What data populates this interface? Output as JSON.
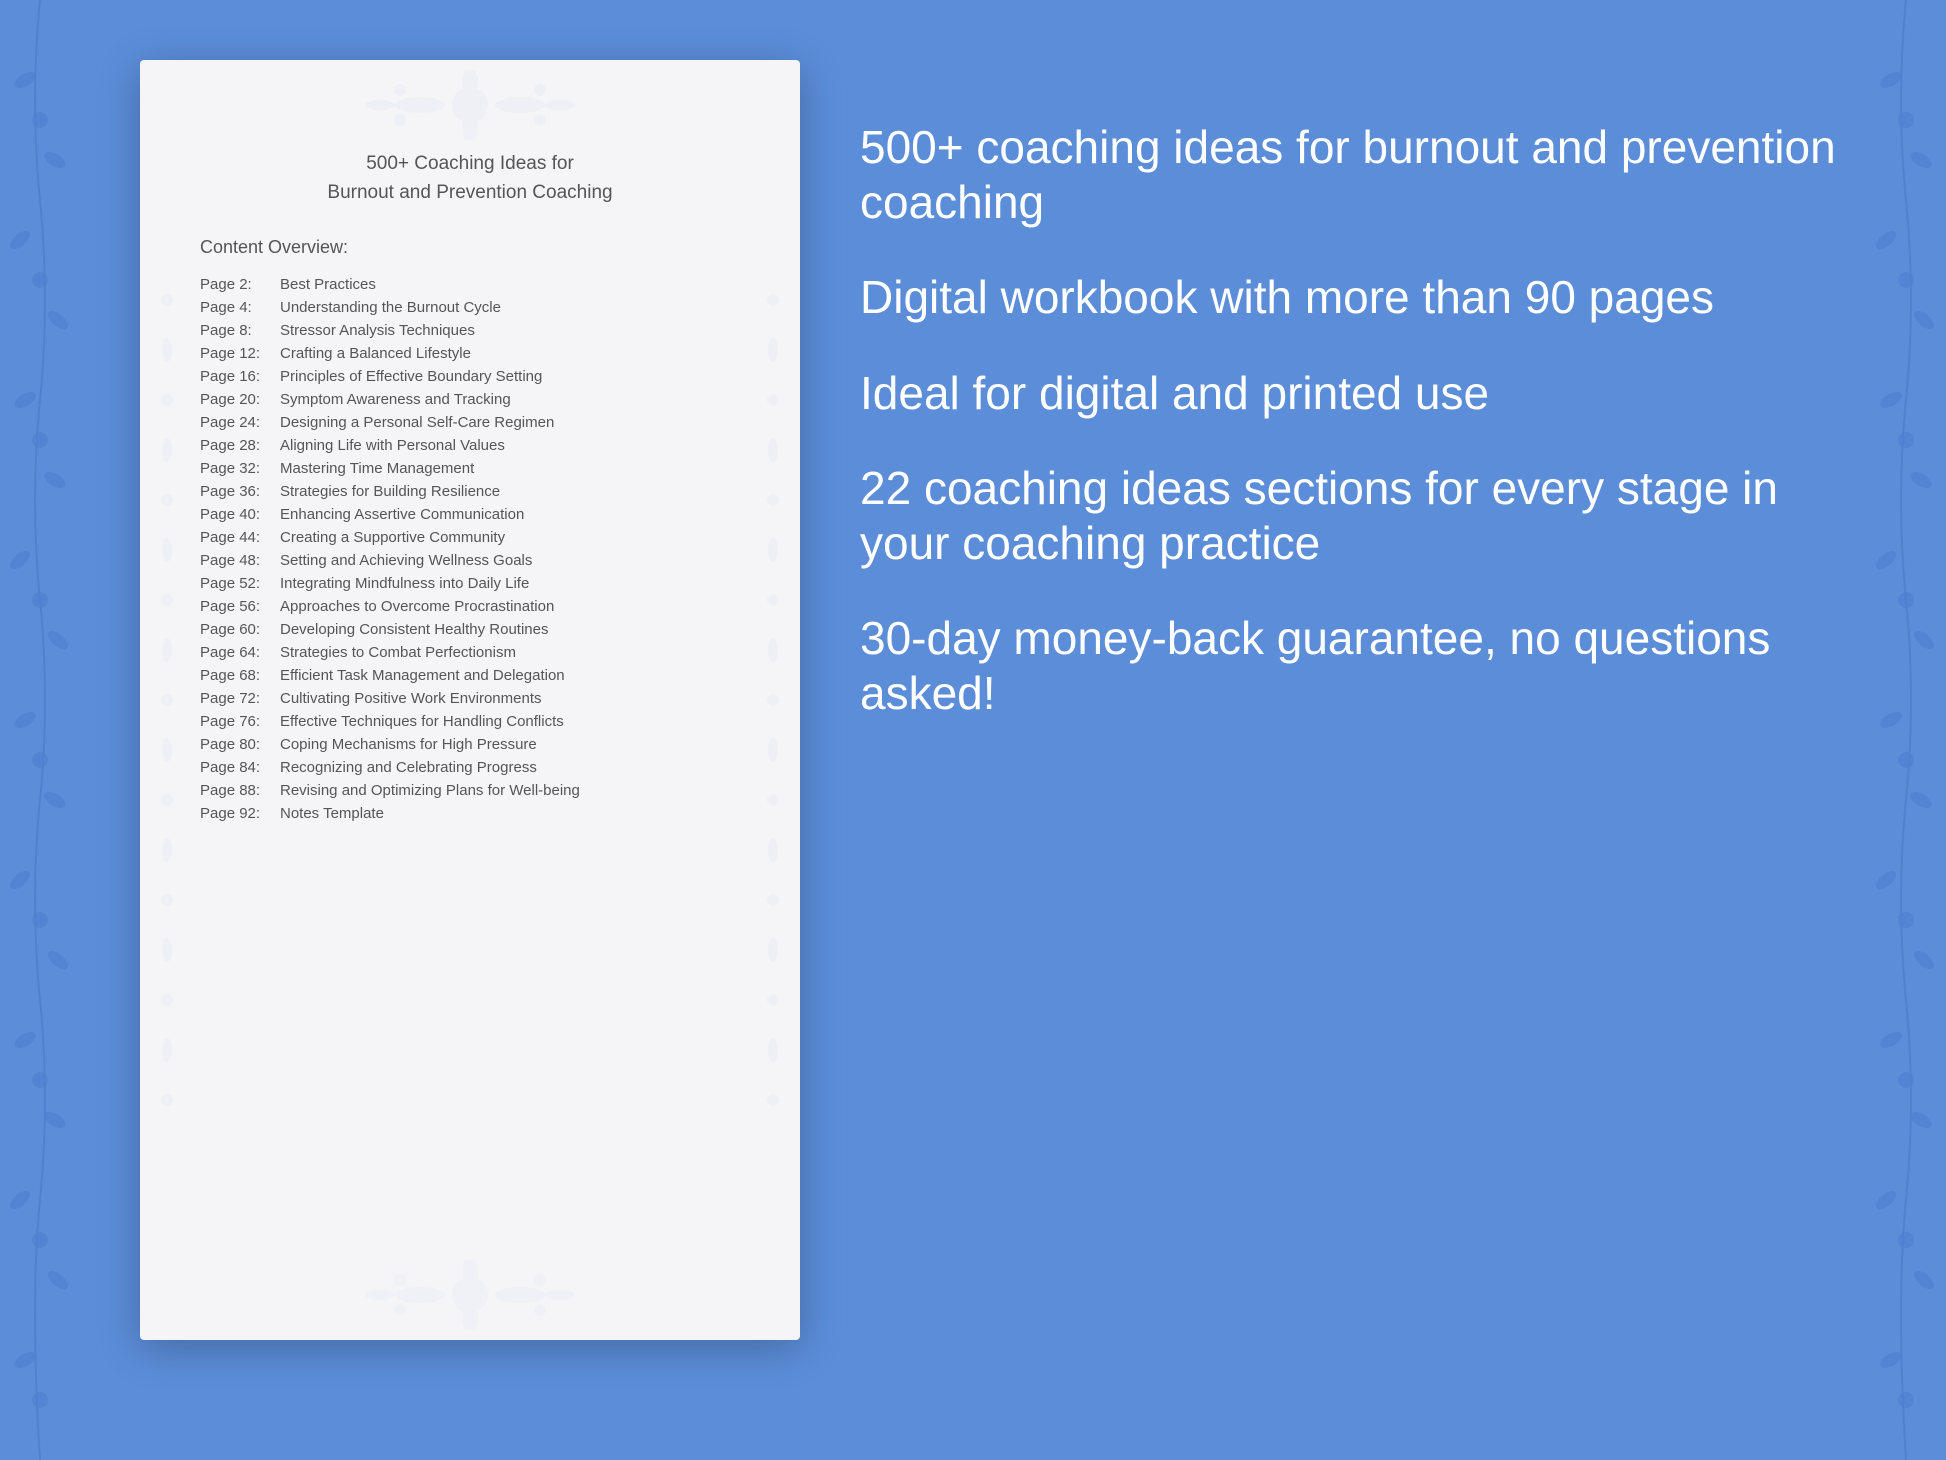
{
  "background_color": "#5b8dd9",
  "document": {
    "title_line1": "500+ Coaching Ideas for",
    "title_line2": "Burnout and Prevention Coaching",
    "content_overview_label": "Content Overview:",
    "toc_items": [
      {
        "page": "Page  2:",
        "title": "Best Practices"
      },
      {
        "page": "Page  4:",
        "title": "Understanding the Burnout Cycle"
      },
      {
        "page": "Page  8:",
        "title": "Stressor Analysis Techniques"
      },
      {
        "page": "Page 12:",
        "title": "Crafting a Balanced Lifestyle"
      },
      {
        "page": "Page 16:",
        "title": "Principles of Effective Boundary Setting"
      },
      {
        "page": "Page 20:",
        "title": "Symptom Awareness and Tracking"
      },
      {
        "page": "Page 24:",
        "title": "Designing a Personal Self-Care Regimen"
      },
      {
        "page": "Page 28:",
        "title": "Aligning Life with Personal Values"
      },
      {
        "page": "Page 32:",
        "title": "Mastering Time Management"
      },
      {
        "page": "Page 36:",
        "title": "Strategies for Building Resilience"
      },
      {
        "page": "Page 40:",
        "title": "Enhancing Assertive Communication"
      },
      {
        "page": "Page 44:",
        "title": "Creating a Supportive Community"
      },
      {
        "page": "Page 48:",
        "title": "Setting and Achieving Wellness Goals"
      },
      {
        "page": "Page 52:",
        "title": "Integrating Mindfulness into Daily Life"
      },
      {
        "page": "Page 56:",
        "title": "Approaches to Overcome Procrastination"
      },
      {
        "page": "Page 60:",
        "title": "Developing Consistent Healthy Routines"
      },
      {
        "page": "Page 64:",
        "title": "Strategies to Combat Perfectionism"
      },
      {
        "page": "Page 68:",
        "title": "Efficient Task Management and Delegation"
      },
      {
        "page": "Page 72:",
        "title": "Cultivating Positive Work Environments"
      },
      {
        "page": "Page 76:",
        "title": "Effective Techniques for Handling Conflicts"
      },
      {
        "page": "Page 80:",
        "title": "Coping Mechanisms for High Pressure"
      },
      {
        "page": "Page 84:",
        "title": "Recognizing and Celebrating Progress"
      },
      {
        "page": "Page 88:",
        "title": "Revising and Optimizing Plans for Well-being"
      },
      {
        "page": "Page 92:",
        "title": "Notes Template"
      }
    ]
  },
  "features": [
    "500+ coaching ideas for burnout and prevention coaching",
    "Digital workbook with more than 90 pages",
    "Ideal for digital and printed use",
    "22 coaching ideas sections for every stage in your coaching practice",
    "30-day money-back guarantee, no questions asked!"
  ]
}
